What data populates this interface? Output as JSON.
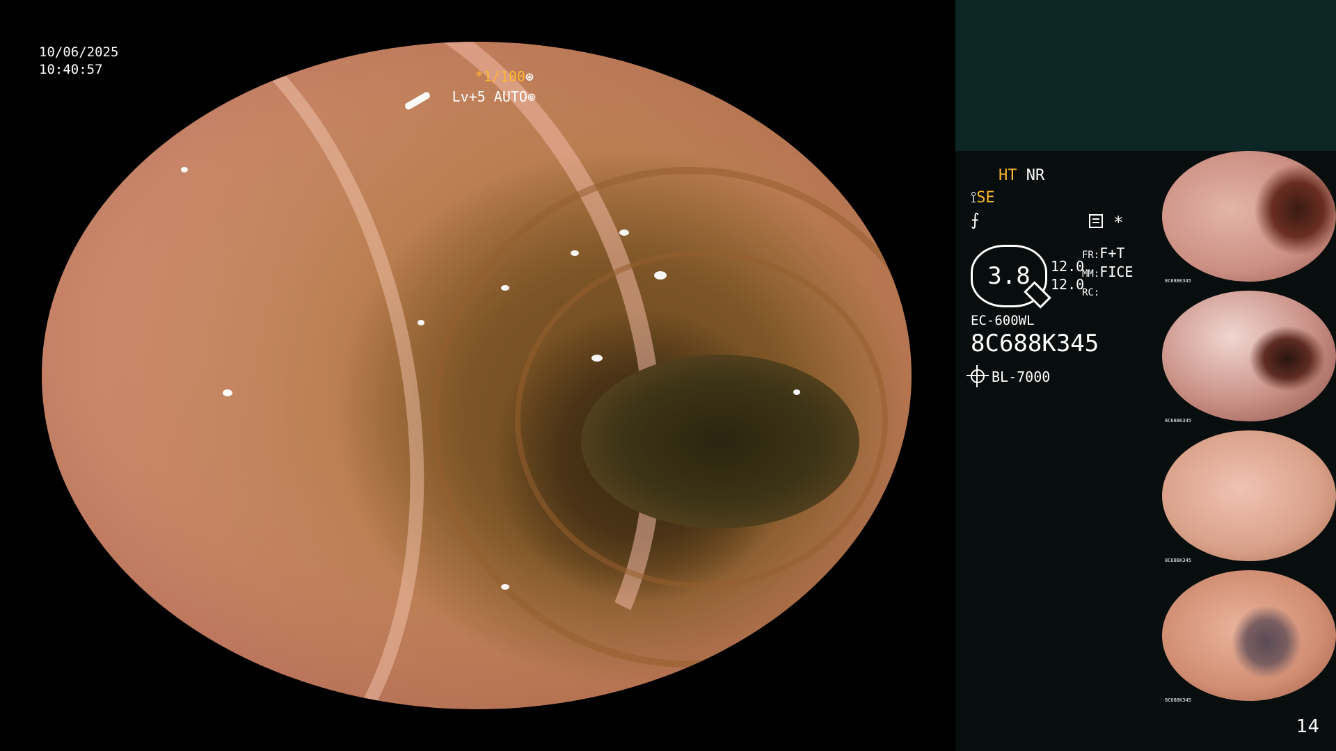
{
  "osd": {
    "date": "10/06/2025",
    "time": "10:40:57",
    "shutter": "*1/100",
    "shutter_symbol": "⊛",
    "level": "Lv+5 AUTO",
    "level_symbol": "⊚"
  },
  "panel": {
    "ht": "HT",
    "nr": "NR",
    "se": "SE",
    "se_symbol": "⟟",
    "f_symbol": "⨍",
    "asterisk": "*",
    "zoom": "3.8",
    "values": [
      "12.0",
      "12.0"
    ],
    "params": [
      {
        "key": "FR:",
        "value": "F+T"
      },
      {
        "key": "MM:",
        "value": "FICE"
      },
      {
        "key": "RC:",
        "value": ""
      }
    ],
    "model": "EC-600WL",
    "serial": "8C688K345",
    "light_source": "BL-7000"
  },
  "thumbnails": [
    {
      "label": "8C688K345"
    },
    {
      "label": "8C688K345"
    },
    {
      "label": "8C688K345"
    },
    {
      "label": "8C688K345"
    }
  ],
  "page_number": "14",
  "colors": {
    "accent": "#ffb830",
    "panel_top": "#0c2625",
    "panel_bg": "#080d0d"
  }
}
